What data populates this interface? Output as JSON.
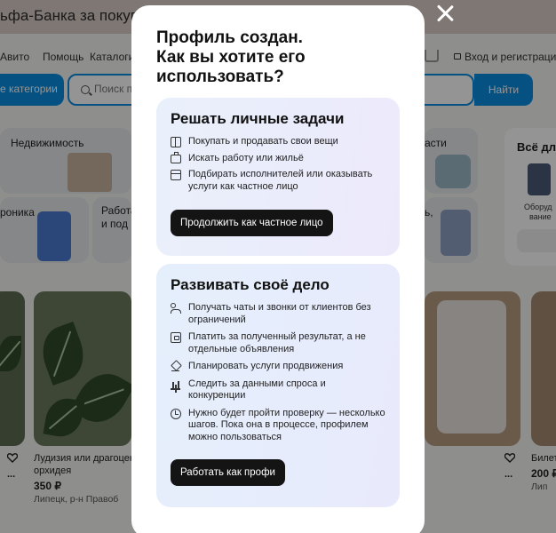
{
  "background": {
    "promo_text": "ьфа-Банка за покупки с А",
    "nav": [
      "Авито",
      "Помощь",
      "Каталоги"
    ],
    "login": "Вход и регистрация",
    "categories_btn": "е категории",
    "search_placeholder": "Поиск по",
    "search_btn": "Найти",
    "tiles": {
      "realty": "Недвижимость",
      "electronics": "роника",
      "work_line1": "Работа",
      "work_line2": "и под",
      "hobby": "асти",
      "services": "ь,"
    },
    "side_card": {
      "title": "Всё дл",
      "sub_line1": "Оборуд",
      "sub_line2": "вание"
    },
    "listing1": {
      "title_line1": "Лудизия или драгоцен",
      "title_line2": "орхидея",
      "dots": "...",
      "price": "350 ₽",
      "location": "Липецк, р-н Правоб"
    },
    "listing2": {
      "title": "Билет",
      "dots": "...",
      "price": "200 ₽",
      "location": "Лип"
    }
  },
  "modal": {
    "title": "Профиль создан.\nКак вы хотите его использовать?",
    "personal": {
      "title": "Решать личные задачи",
      "features": [
        {
          "icon": "box-icon",
          "text": "Покупать и продавать свои вещи"
        },
        {
          "icon": "briefcase-icon",
          "text": "Искать работу или жильё"
        },
        {
          "icon": "calendar-icon",
          "text": "Подбирать исполнителей или оказывать услуги как частное лицо"
        }
      ],
      "button": "Продолжить как частное лицо"
    },
    "business": {
      "title": "Развивать своё дело",
      "features": [
        {
          "icon": "users-icon",
          "text": "Получать чаты и звонки от клиентов без ограничений"
        },
        {
          "icon": "wallet-icon",
          "text": "Платить за полученный результат, а не отдельные объявления"
        },
        {
          "icon": "rocket-icon",
          "text": "Планировать услуги продвижения"
        },
        {
          "icon": "chart-icon",
          "text": "Следить за данными спроса и конкуренции"
        },
        {
          "icon": "clock-icon",
          "text": "Нужно будет пройти проверку — несколько шагов. Пока она в процессе, профилем можно пользоваться"
        }
      ],
      "button": "Работать как профи"
    }
  }
}
